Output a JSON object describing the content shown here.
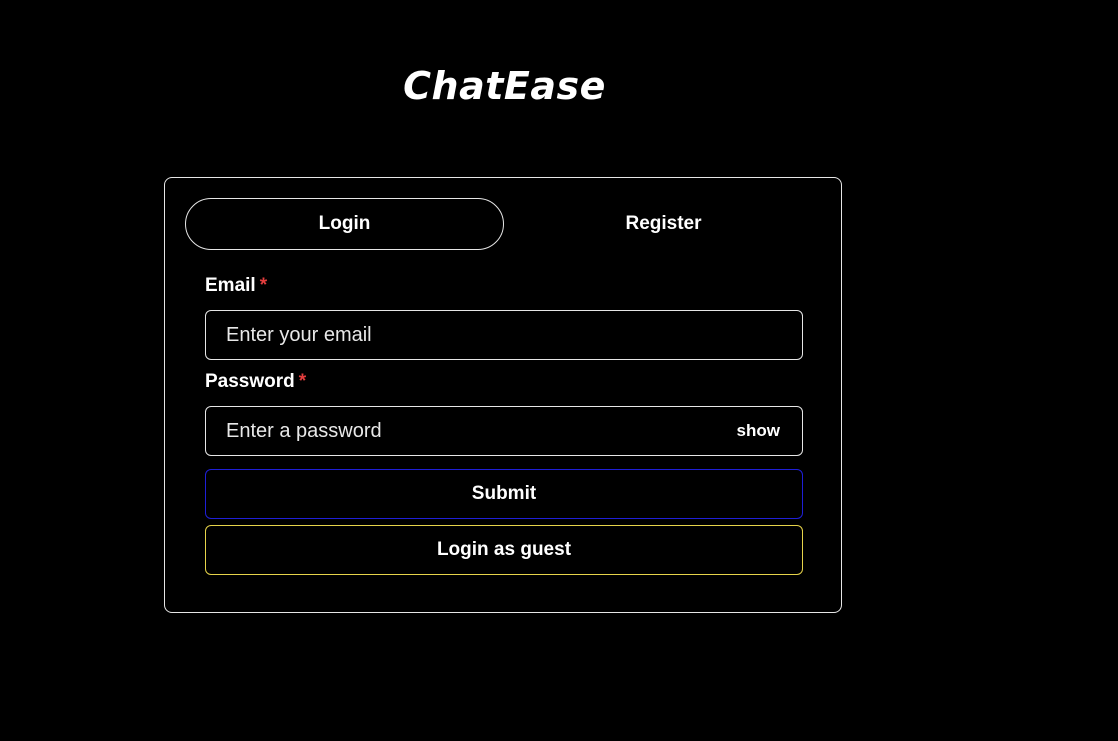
{
  "app": {
    "title": "ChatEase"
  },
  "tabs": [
    {
      "label": "Login",
      "active": true
    },
    {
      "label": "Register",
      "active": false
    }
  ],
  "form": {
    "email": {
      "label": "Email",
      "required_mark": "*",
      "placeholder": "Enter your email",
      "value": ""
    },
    "password": {
      "label": "Password",
      "required_mark": "*",
      "placeholder": "Enter a password",
      "value": "",
      "toggle_label": "show"
    },
    "submit_label": "Submit",
    "guest_label": "Login as guest"
  },
  "colors": {
    "background": "#000000",
    "text": "#ffffff",
    "required": "#e53e3e",
    "submit_border": "#1f1fd6",
    "guest_border": "#e6d34a",
    "outline": "#e6e6e6"
  }
}
